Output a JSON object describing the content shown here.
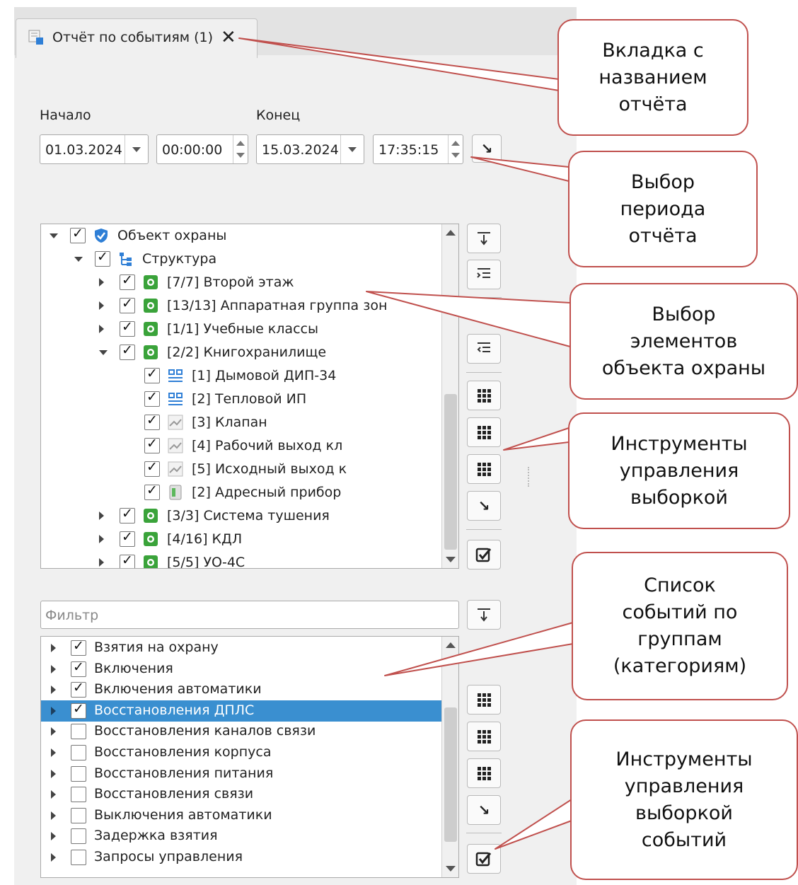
{
  "tab": {
    "title": "Отчёт по событиям (1)",
    "close_glyph": "✕"
  },
  "period": {
    "start_label": "Начало",
    "end_label": "Конец",
    "start_date": "01.03.2024",
    "start_time": "00:00:00",
    "end_date": "15.03.2024",
    "end_time": "17:35:15"
  },
  "object_tree": {
    "rows": [
      {
        "text": "Объект охраны",
        "expander": "open",
        "checked": true,
        "icon": "shield-icon"
      },
      {
        "text": "Структура",
        "expander": "open",
        "checked": true,
        "icon": "structure-icon"
      },
      {
        "text": "[7/7] Второй этаж",
        "expander": "closed",
        "checked": true,
        "icon": "zone-group-icon"
      },
      {
        "text": "[13/13] Аппаратная группа зон",
        "expander": "closed",
        "checked": true,
        "icon": "zone-group-icon"
      },
      {
        "text": "[1/1] Учебные классы",
        "expander": "closed",
        "checked": true,
        "icon": "zone-group-icon"
      },
      {
        "text": "[2/2] Книгохранилище",
        "expander": "open",
        "checked": true,
        "icon": "zone-group-icon"
      },
      {
        "text": "[1] Дымовой ДИП-34",
        "expander": "none",
        "checked": true,
        "icon": "detector-icon"
      },
      {
        "text": "[2] Тепловой ИП",
        "expander": "none",
        "checked": true,
        "icon": "detector-icon"
      },
      {
        "text": "[3] Клапан",
        "expander": "none",
        "checked": true,
        "icon": "output-icon"
      },
      {
        "text": "[4] Рабочий выход кл",
        "expander": "none",
        "checked": true,
        "icon": "output-icon"
      },
      {
        "text": "[5] Исходный выход к",
        "expander": "none",
        "checked": true,
        "icon": "output-icon"
      },
      {
        "text": "[2] Адресный прибор",
        "expander": "none",
        "checked": true,
        "icon": "device-icon"
      },
      {
        "text": "[3/3] Система тушения",
        "expander": "closed",
        "checked": true,
        "icon": "zone-group-icon"
      },
      {
        "text": "[4/16] КДЛ",
        "expander": "closed",
        "checked": true,
        "icon": "zone-group-icon"
      },
      {
        "text": "[5/5] УО-4С",
        "expander": "closed",
        "checked": true,
        "icon": "zone-group-icon"
      }
    ]
  },
  "events": {
    "filter_placeholder": "Фильтр",
    "rows": [
      {
        "text": "Взятия на охрану",
        "checked": true,
        "selected": false
      },
      {
        "text": "Включения",
        "checked": true,
        "selected": false
      },
      {
        "text": "Включения автоматики",
        "checked": true,
        "selected": false
      },
      {
        "text": "Восстановления ДПЛС",
        "checked": true,
        "selected": true
      },
      {
        "text": "Восстановления каналов связи",
        "checked": false,
        "selected": false
      },
      {
        "text": "Восстановления корпуса",
        "checked": false,
        "selected": false
      },
      {
        "text": "Восстановления питания",
        "checked": false,
        "selected": false
      },
      {
        "text": "Восстановления связи",
        "checked": false,
        "selected": false
      },
      {
        "text": "Выключения автоматики",
        "checked": false,
        "selected": false
      },
      {
        "text": "Задержка взятия",
        "checked": false,
        "selected": false
      },
      {
        "text": "Запросы управления",
        "checked": false,
        "selected": false
      }
    ]
  },
  "callouts": {
    "tab_name": "Вкладка с\nназванием\nотчёта",
    "period": "Выбор\nпериода\nотчёта",
    "elements": "Выбор\nэлементов\nобъекта охраны",
    "tools": "Инструменты\nуправления\nвыборкой",
    "events_list": "Список\nсобытий по\nгруппам\n(категориям)",
    "events_tools": "Инструменты\nуправления\nвыборкой\nсобытий"
  },
  "colors": {
    "selection": "#3a8fd0",
    "callout_border": "#c0504d",
    "zone_icon": "#3aa33a",
    "shield_icon": "#2f7fd6"
  }
}
